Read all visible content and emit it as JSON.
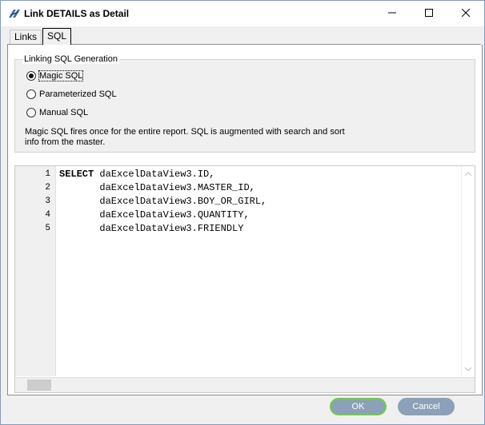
{
  "window": {
    "title": "Link DETAILS as Detail",
    "icons": {
      "app": "link-app-icon",
      "minimize": "minimize-icon",
      "maximize": "maximize-icon",
      "close": "close-icon"
    }
  },
  "tabs": [
    {
      "label": "Links",
      "active": false
    },
    {
      "label": "SQL",
      "active": true
    }
  ],
  "linking": {
    "legend": "Linking SQL Generation",
    "options": [
      {
        "label": "Magic SQL",
        "selected": true
      },
      {
        "label": "Parameterized SQL",
        "selected": false
      },
      {
        "label": "Manual SQL",
        "selected": false
      }
    ],
    "description_line1": "Magic SQL fires once for the entire report. SQL is augmented with search and sort",
    "description_line2": "info from the master."
  },
  "editor": {
    "lines": [
      {
        "no": "1",
        "keyword": "SELECT",
        "text": " daExcelDataView3.ID,"
      },
      {
        "no": "2",
        "keyword": "",
        "text": "       daExcelDataView3.MASTER_ID,"
      },
      {
        "no": "3",
        "keyword": "",
        "text": "       daExcelDataView3.BOY_OR_GIRL,"
      },
      {
        "no": "4",
        "keyword": "",
        "text": "       daExcelDataView3.QUANTITY,"
      },
      {
        "no": "5",
        "keyword": "",
        "text": "       daExcelDataView3.FRIENDLY"
      }
    ]
  },
  "buttons": {
    "ok": "OK",
    "cancel": "Cancel"
  },
  "colors": {
    "button": "#8ca1b8",
    "ok_focus": "#6bd13f"
  }
}
